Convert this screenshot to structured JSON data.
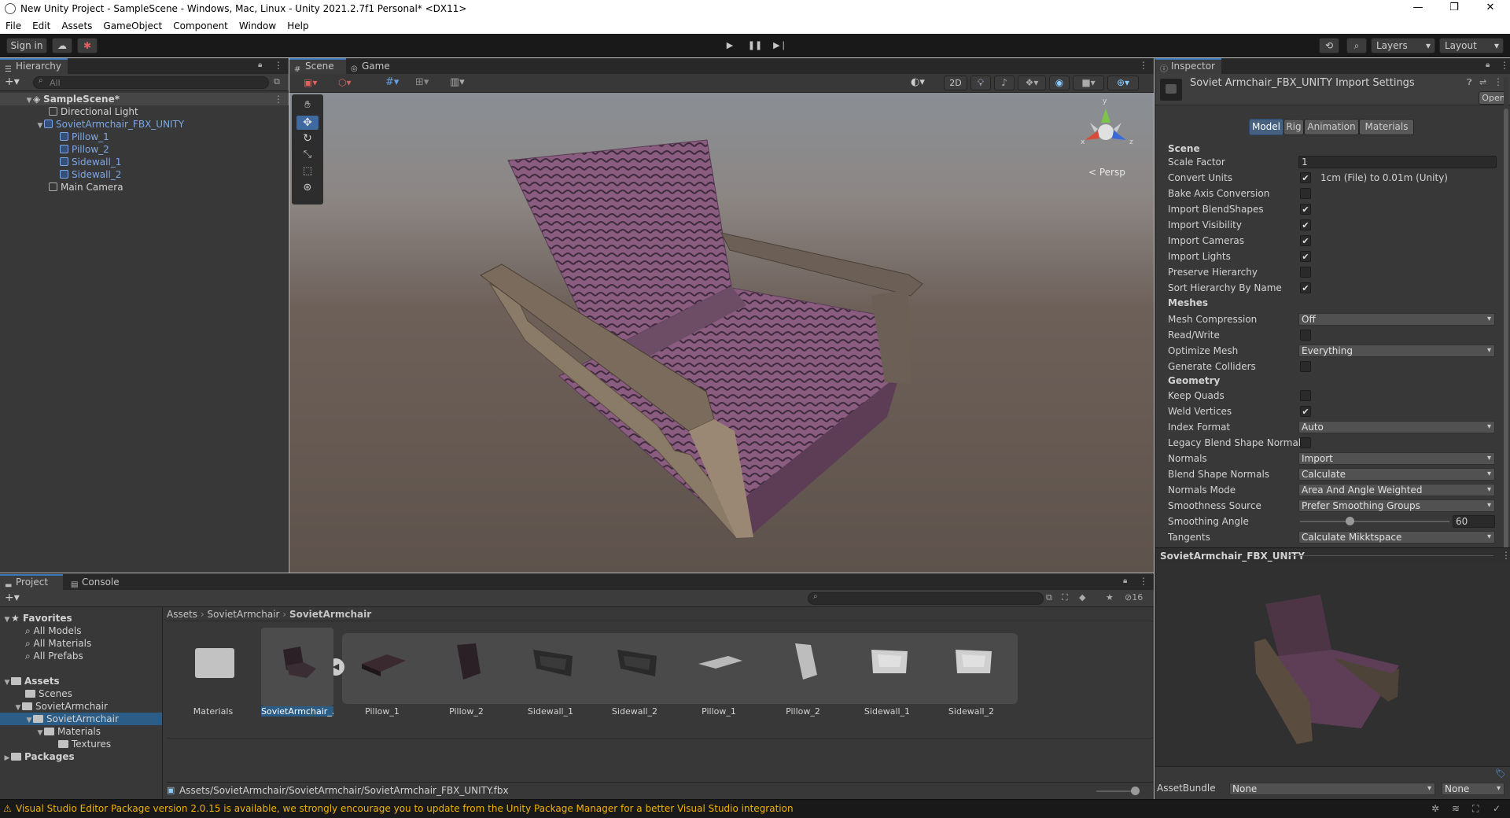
{
  "window": {
    "title": "New Unity Project - SampleScene - Windows, Mac, Linux - Unity 2021.2.7f1 Personal* <DX11>",
    "minimize": "—",
    "maximize": "❐",
    "close": "✕"
  },
  "menu": [
    "File",
    "Edit",
    "Assets",
    "GameObject",
    "Component",
    "Window",
    "Help"
  ],
  "toolbar": {
    "sign_in": "Sign in",
    "layers": "Layers",
    "layout": "Layout"
  },
  "hierarchy": {
    "tab": "Hierarchy",
    "search_placeholder": "All",
    "scene": "SampleScene*",
    "items": [
      "Directional Light",
      "SovietArmchair_FBX_UNITY",
      "Pillow_1",
      "Pillow_2",
      "Sidewall_1",
      "Sidewall_2",
      "Main Camera"
    ]
  },
  "scene_view": {
    "tabs": [
      "Scene",
      "Game"
    ],
    "mode_2d": "2D",
    "persp": "< Persp",
    "axis_y": "y",
    "axis_x": "x",
    "axis_z": "z"
  },
  "inspector": {
    "tab": "Inspector",
    "title": "Soviet Armchair_FBX_UNITY Import Settings",
    "open": "Open",
    "tabs": [
      "Model",
      "Rig",
      "Animation",
      "Materials"
    ],
    "sections": {
      "scene": "Scene",
      "meshes": "Meshes",
      "geometry": "Geometry"
    },
    "scale_factor_label": "Scale Factor",
    "scale_factor": "1",
    "convert_units_label": "Convert Units",
    "convert_units_note": "1cm (File) to 0.01m (Unity)",
    "bake_axis": "Bake Axis Conversion",
    "import_blendshapes": "Import BlendShapes",
    "import_visibility": "Import Visibility",
    "import_cameras": "Import Cameras",
    "import_lights": "Import Lights",
    "preserve_hierarchy": "Preserve Hierarchy",
    "sort_hierarchy": "Sort Hierarchy By Name",
    "mesh_compression_label": "Mesh Compression",
    "mesh_compression": "Off",
    "read_write": "Read/Write",
    "optimize_mesh_label": "Optimize Mesh",
    "optimize_mesh": "Everything",
    "generate_colliders": "Generate Colliders",
    "keep_quads": "Keep Quads",
    "weld_vertices": "Weld Vertices",
    "index_format_label": "Index Format",
    "index_format": "Auto",
    "legacy_blend": "Legacy Blend Shape Normals",
    "normals_label": "Normals",
    "normals": "Import",
    "blend_normals_label": "Blend Shape Normals",
    "blend_normals": "Calculate",
    "normals_mode_label": "Normals Mode",
    "normals_mode": "Area And Angle Weighted",
    "smoothness_source_label": "Smoothness Source",
    "smoothness_source": "Prefer Smoothing Groups",
    "smoothing_angle_label": "Smoothing Angle",
    "smoothing_angle": "60",
    "smoothing_angle_fraction": 0.33,
    "tangents_label": "Tangents",
    "tangents": "Calculate Mikktspace",
    "preview_title": "SovietArmchair_FBX_UNITY",
    "assetbundle_label": "AssetBundle",
    "assetbundle": "None",
    "assetbundle_variant": "None"
  },
  "project": {
    "tabs": [
      "Project",
      "Console"
    ],
    "favorites": "Favorites",
    "fav_items": [
      "All Models",
      "All Materials",
      "All Prefabs"
    ],
    "assets": "Assets",
    "tree": [
      "Scenes",
      "SovietArmchair",
      "SovietArmchair",
      "Materials",
      "Textures"
    ],
    "packages": "Packages",
    "breadcrumb": [
      "Assets",
      "SovietArmchair",
      "SovietArmchair"
    ],
    "hidden_count": "16",
    "items": [
      "Materials",
      "SovietArmchair_...",
      "Pillow_1",
      "Pillow_2",
      "Sidewall_1",
      "Sidewall_2",
      "Pillow_1",
      "Pillow_2",
      "Sidewall_1",
      "Sidewall_2"
    ],
    "path": "Assets/SovietArmchair/SovietArmchair/SovietArmchair_FBX_UNITY.fbx"
  },
  "status": {
    "message": "Visual Studio Editor Package version 2.0.15 is available, we strongly encourage you to update from the Unity Package Manager for a better Visual Studio integration"
  },
  "colors": {
    "accent": "#3a79bb",
    "selected_blue": "#7ca8e8",
    "panel": "#383838",
    "warning": "#f0b400"
  }
}
